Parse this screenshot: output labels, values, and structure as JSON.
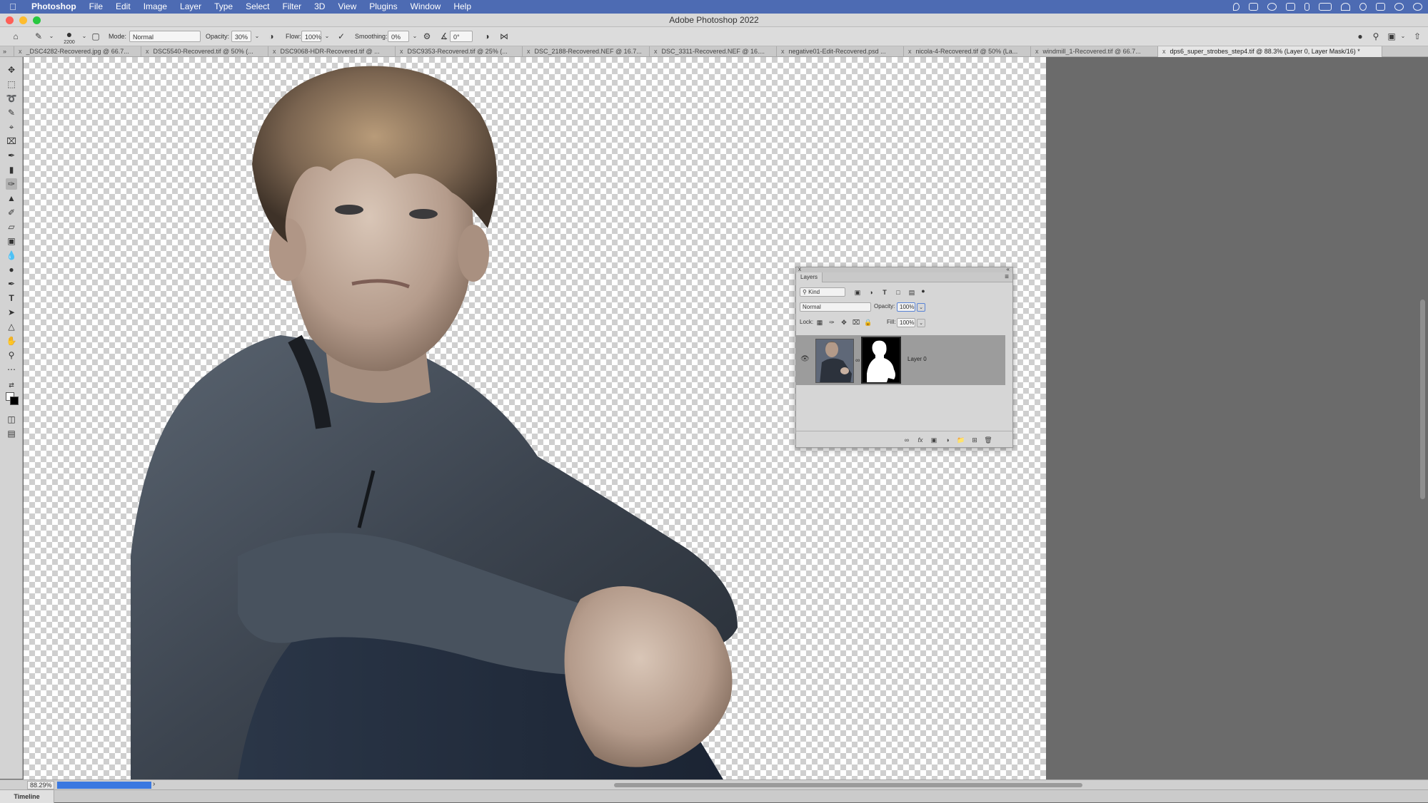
{
  "menubar": {
    "app": "Photoshop",
    "items": [
      "File",
      "Edit",
      "Image",
      "Layer",
      "Type",
      "Select",
      "Filter",
      "3D",
      "View",
      "Plugins",
      "Window",
      "Help"
    ]
  },
  "window": {
    "title": "Adobe Photoshop 2022"
  },
  "options": {
    "brush_size": "2200",
    "mode_label": "Mode:",
    "mode_value": "Normal",
    "opacity_label": "Opacity:",
    "opacity_value": "30%",
    "flow_label": "Flow:",
    "flow_value": "100%",
    "smoothing_label": "Smoothing:",
    "smoothing_value": "0%",
    "angle_value": "0°"
  },
  "tabs": [
    "_DSC4282-Recovered.jpg @ 66.7...",
    "DSC5540-Recovered.tif @ 50% (...",
    "DSC9068-HDR-Recovered.tif @ ...",
    "DSC9353-Recovered.tif @ 25% (...",
    "DSC_2188-Recovered.NEF @ 16.7...",
    "DSC_3311-Recovered.NEF @ 16....",
    "negative01-Edit-Recovered.psd ...",
    "nicola-4-Recovered.tif @ 50% (La...",
    "windmill_1-Recovered.tif @ 66.7...",
    "dps6_super_strobes_step4.tif @ 88.3% (Layer 0, Layer Mask/16) *"
  ],
  "layers_panel": {
    "tab_label": "Layers",
    "kind_label": "Kind",
    "blend_mode": "Normal",
    "opacity_label": "Opacity:",
    "opacity_value": "100%",
    "lock_label": "Lock:",
    "fill_label": "Fill:",
    "fill_value": "100%",
    "layer_name": "Layer 0"
  },
  "status": {
    "zoom": "88.29%",
    "timeline_label": "Timeline"
  },
  "colors": {
    "menubar": "#4d6bb3",
    "progress": "#3a78e0"
  }
}
